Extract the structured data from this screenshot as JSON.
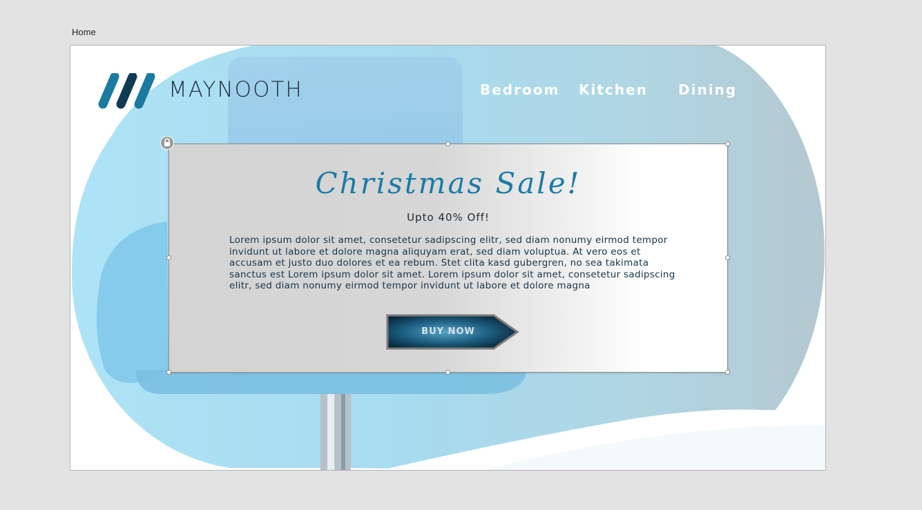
{
  "page": {
    "label": "Home"
  },
  "header": {
    "brand": "MAYNOOTH",
    "logo_icon": "slanted-bars-logo",
    "nav": [
      {
        "label": "Bedroom"
      },
      {
        "label": "Kitchen"
      },
      {
        "label": "Dining"
      }
    ]
  },
  "banner": {
    "title": "Christmas Sale!",
    "subtitle": "Upto 40% Off!",
    "body": "Lorem ipsum dolor sit amet, consetetur sadipscing elitr, sed diam nonumy eirmod tempor invidunt ut labore et dolore magna aliquyam erat, sed diam voluptua. At vero eos et accusam et justo duo dolores et ea rebum. Stet clita kasd gubergren, no sea takimata sanctus est Lorem ipsum dolor sit amet. Lorem ipsum dolor sit amet, consetetur sadipscing elitr, sed diam nonumy eirmod tempor invidunt ut labore et dolore magna",
    "cta": "BUY NOW",
    "lock_icon": "lock-icon"
  },
  "colors": {
    "accent": "#1a7ca6",
    "hero_light": "#a8def2",
    "hero_dark": "#aebfc6",
    "logo_light": "#1b7aa0",
    "logo_dark": "#0e3b52",
    "button_dark": "#0c3247"
  }
}
